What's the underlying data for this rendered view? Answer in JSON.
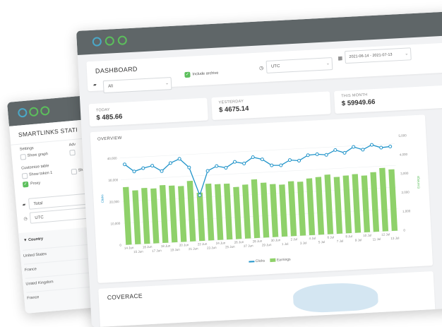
{
  "back_window": {
    "title": "SMARTLINKS STATI",
    "settings_label": "Settings",
    "adv_label": "Adv",
    "show_graph": "Show graph",
    "customize_table": "Customize table",
    "show_token": "Show token 1",
    "show_short": "Sh",
    "proxy": "Proxy",
    "total_select": "Total",
    "utc_select": "UTC",
    "country_header": "Country",
    "countries": [
      "United States",
      "France",
      "United Kingdom",
      "France"
    ]
  },
  "front_window": {
    "title": "DASHBOARD",
    "filter_select": "All",
    "include_archive": "Include archive",
    "timezone_select": "UTC",
    "date_range": "2021-06-14 - 2021-07-13",
    "stats": {
      "today_label": "TODAY",
      "today_value": "$ 485.66",
      "yesterday_label": "YESTERDAY",
      "yesterday_value": "$ 4675.14",
      "month_label": "THIS MONTH",
      "month_value": "$ 59949.66"
    },
    "overview_title": "OVERVIEW",
    "coverage_title": "COVERACE",
    "legend_clicks": "Clicks",
    "legend_earnings": "Earnings"
  },
  "colors": {
    "titlebar": "#5f6668",
    "bar": "#8fd16a",
    "line": "#1f93c9",
    "check": "#5cbf5c"
  },
  "chart_data": {
    "type": "bar",
    "categories": [
      "14 Jun",
      "15 Jun",
      "16 Jun",
      "17 Jun",
      "18 Jun",
      "19 Jun",
      "20 Jun",
      "21 Jun",
      "22 Jun",
      "23 Jun",
      "24 Jun",
      "25 Jun",
      "26 Jun",
      "27 Jun",
      "28 Jun",
      "29 Jun",
      "30 Jun",
      "1 Jul",
      "2 Jul",
      "3 Jul",
      "4 Jul",
      "5 Jul",
      "6 Jul",
      "7 Jul",
      "8 Jul",
      "9 Jul",
      "10 Jul",
      "11 Jul",
      "12 Jul",
      "13 Jul"
    ],
    "x_tick_labels": [
      "14 Jun",
      "15 Jun",
      "16 Jun",
      "17 Jun",
      "18 Jun",
      "19 Jun",
      "20 Jun",
      "21 Jun",
      "22 Jun",
      "23 Jun",
      "24 Jun",
      "25 Jun",
      "26 Jun",
      "27 Jun",
      "28 Jun",
      "29 Jun",
      "30 Jun",
      "1 Jul",
      "2 Jul",
      "3 Jul",
      "4 Jul",
      "5 Jul",
      "6 Jul",
      "7 Jul",
      "8 Jul",
      "9 Jul",
      "10 Jul",
      "11 Jul",
      "12 Jul",
      "13 Jul"
    ],
    "series": [
      {
        "name": "Earnings",
        "axis": "right",
        "values": [
          3050,
          2850,
          2950,
          2900,
          3050,
          3000,
          2950,
          3200,
          2550,
          3000,
          2950,
          2950,
          2750,
          2850,
          3100,
          2900,
          2800,
          2750,
          2900,
          2850,
          3000,
          3050,
          3150,
          3000,
          3050,
          3100,
          3000,
          3150,
          3350,
          3250
        ]
      },
      {
        "name": "Clicks",
        "axis": "left",
        "values": [
          37000,
          33500,
          34800,
          35700,
          33000,
          36500,
          38200,
          34000,
          21000,
          32000,
          34000,
          33000,
          35500,
          34500,
          37200,
          36000,
          33000,
          32800,
          35000,
          34500,
          36800,
          37000,
          36500,
          38500,
          37000,
          39500,
          38000,
          40000,
          38500,
          38800
        ]
      }
    ],
    "y_left": {
      "label": "Clicks",
      "ticks": [
        "0",
        "10,000",
        "20,000",
        "30,000",
        "40,000"
      ],
      "ylim": [
        0,
        43500
      ]
    },
    "y_right": {
      "label": "Earnings",
      "ticks": [
        "0",
        "1,000",
        "2,000",
        "3,000",
        "4,000",
        "5,000"
      ],
      "ylim": [
        0,
        5000
      ]
    }
  }
}
